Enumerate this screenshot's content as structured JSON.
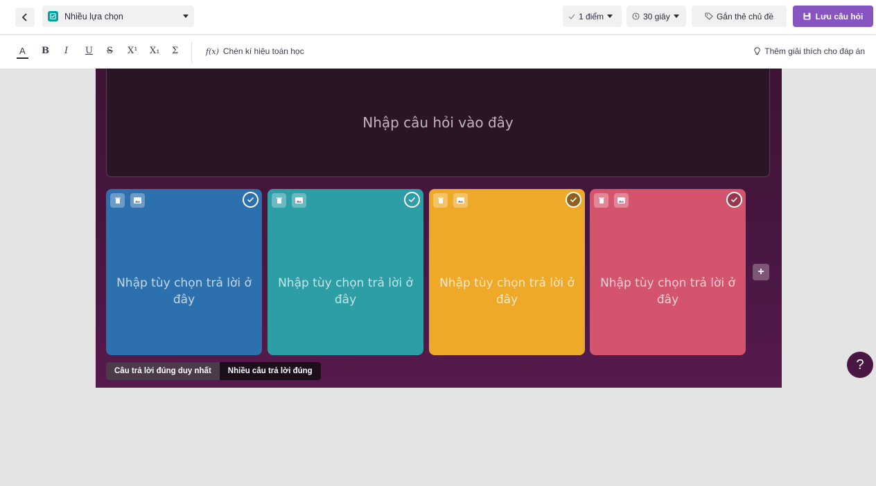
{
  "header": {
    "question_type": "Nhiều lựa chọn",
    "points": "1 điểm",
    "time": "30 giây",
    "tag_label": "Gắn thẻ chủ đề",
    "save_label": "Lưu câu hỏi"
  },
  "toolbar": {
    "format_buttons": [
      "A",
      "B",
      "I",
      "U",
      "S",
      "X¹",
      "X₁",
      "Σ"
    ],
    "math_label": "Chèn kí hiệu toán học",
    "explain_label": "Thêm giải thích cho đáp án"
  },
  "question": {
    "placeholder": "Nhập câu hỏi vào đây"
  },
  "answers": [
    {
      "placeholder": "Nhập tùy chọn trả lời ở đây",
      "color": "#2d70ae"
    },
    {
      "placeholder": "Nhập tùy chọn trả lời ở đây",
      "color": "#2d9da6"
    },
    {
      "placeholder": "Nhập tùy chọn trả lời ở đây",
      "color": "#efa929"
    },
    {
      "placeholder": "Nhập tùy chọn trả lời ở đây",
      "color": "#d5546d"
    }
  ],
  "mode": {
    "single": "Câu trả lời đúng duy nhất",
    "multiple": "Nhiều câu trả lời đúng"
  },
  "help_label": "?",
  "colors": {
    "accent": "#8854c0",
    "editor_bg": "#4a1742"
  }
}
